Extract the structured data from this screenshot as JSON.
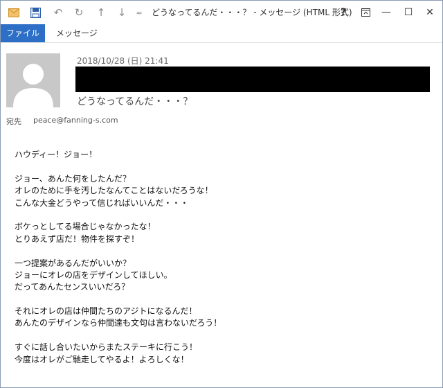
{
  "window": {
    "title": "どうなってるんだ・・・？ - メッセージ (HTML 形式)",
    "accent_color": "#2d6ec6"
  },
  "quick_access": {
    "mail_icon": "mail-icon",
    "save_icon": "save-icon",
    "undo_icon": "undo-icon",
    "redo_icon": "redo-icon",
    "up_icon": "arrow-up-icon",
    "down_icon": "arrow-down-icon",
    "customize_icon": "customize-icon"
  },
  "controls": {
    "help": "?",
    "restore_icon": "ribbon-display-icon",
    "minimize": "—",
    "maximize": "☐",
    "close": "✕"
  },
  "ribbon": {
    "file_tab": "ファイル",
    "message_tab": "メッセージ"
  },
  "header": {
    "date": "2018/10/28 (日) 21:41",
    "subject": "どうなってるんだ・・・？",
    "to_label": "宛先",
    "to_value": "peace@fanning-s.com"
  },
  "body_lines": [
    "ハウディー！ジョー！",
    "",
    "ジョー、あんた何をしたんだ？",
    "オレのために手を汚したなんてことはないだろうな！",
    "こんな大金どうやって信じればいいんだ・・・",
    "",
    "ボケっとしてる場合じゃなかったな！",
    "とりあえず店だ！物件を探すぞ！",
    "",
    "一つ提案があるんだがいいか？",
    "ジョーにオレの店をデザインしてほしい。",
    "だってあんたセンスいいだろ？",
    "",
    "それにオレの店は仲間たちのアジトになるんだ！",
    "あんたのデザインなら仲間達も文句は言わないだろう！",
    "",
    "すぐに話し合いたいからまたステーキに行こう！",
    "今度はオレがご馳走してやるよ！よろしくな！"
  ]
}
